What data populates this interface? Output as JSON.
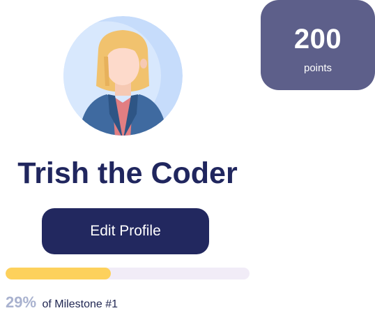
{
  "profile": {
    "name": "Trish the Coder",
    "edit_label": "Edit Profile",
    "avatar_icon": "woman-avatar-icon"
  },
  "points": {
    "value": "200",
    "label": "points"
  },
  "milestone": {
    "percent_label": "29%",
    "text": "of Milestone #1",
    "progress": 0.43
  },
  "colors": {
    "primary": "#22285f",
    "points_card": "#5d5f8a",
    "progress_fill": "#fdd15c",
    "progress_track": "#f1ecf7"
  }
}
